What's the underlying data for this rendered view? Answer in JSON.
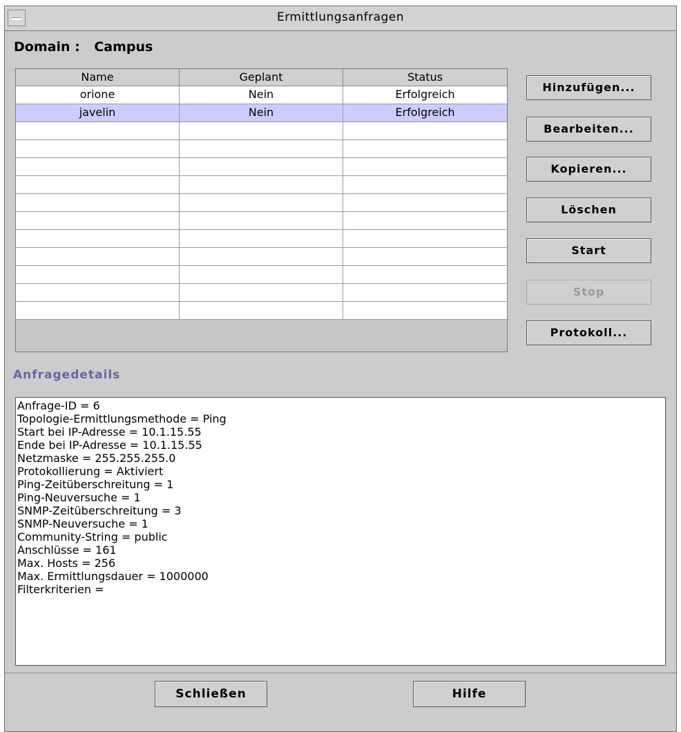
{
  "window": {
    "title": "Ermittlungsanfragen"
  },
  "domain": {
    "label": "Domain :",
    "value": "Campus"
  },
  "table": {
    "columns": [
      "Name",
      "Geplant",
      "Status"
    ],
    "rows": [
      {
        "name": "orione",
        "scheduled": "Nein",
        "status": "Erfolgreich",
        "selected": false
      },
      {
        "name": "javelin",
        "scheduled": "Nein",
        "status": "Erfolgreich",
        "selected": true
      }
    ]
  },
  "actions": {
    "add": "Hinzufügen...",
    "edit": "Bearbeiten...",
    "copy": "Kopieren...",
    "delete": "Löschen",
    "start": "Start",
    "stop": "Stop",
    "log": "Protokoll..."
  },
  "details": {
    "label": "Anfragedetails",
    "lines": [
      "Anfrage-ID = 6",
      "Topologie-Ermittlungsmethode = Ping",
      "Start bei IP-Adresse = 10.1.15.55",
      "Ende bei IP-Adresse = 10.1.15.55",
      "Netzmaske = 255.255.255.0",
      "Protokollierung = Aktiviert",
      "Ping-Zeitüberschreitung = 1",
      "Ping-Neuversuche = 1",
      "SNMP-Zeitüberschreitung = 3",
      "SNMP-Neuversuche = 1",
      "Community-String = public",
      "Anschlüsse = 161",
      "Max. Hosts = 256",
      "Max. Ermittlungsdauer = 1000000",
      "Filterkriterien ="
    ]
  },
  "footer": {
    "close": "Schließen",
    "help": "Hilfe"
  },
  "colors": {
    "window_bg": "#cccccc",
    "selection": "#ccccff",
    "details_label": "#6666aa"
  }
}
